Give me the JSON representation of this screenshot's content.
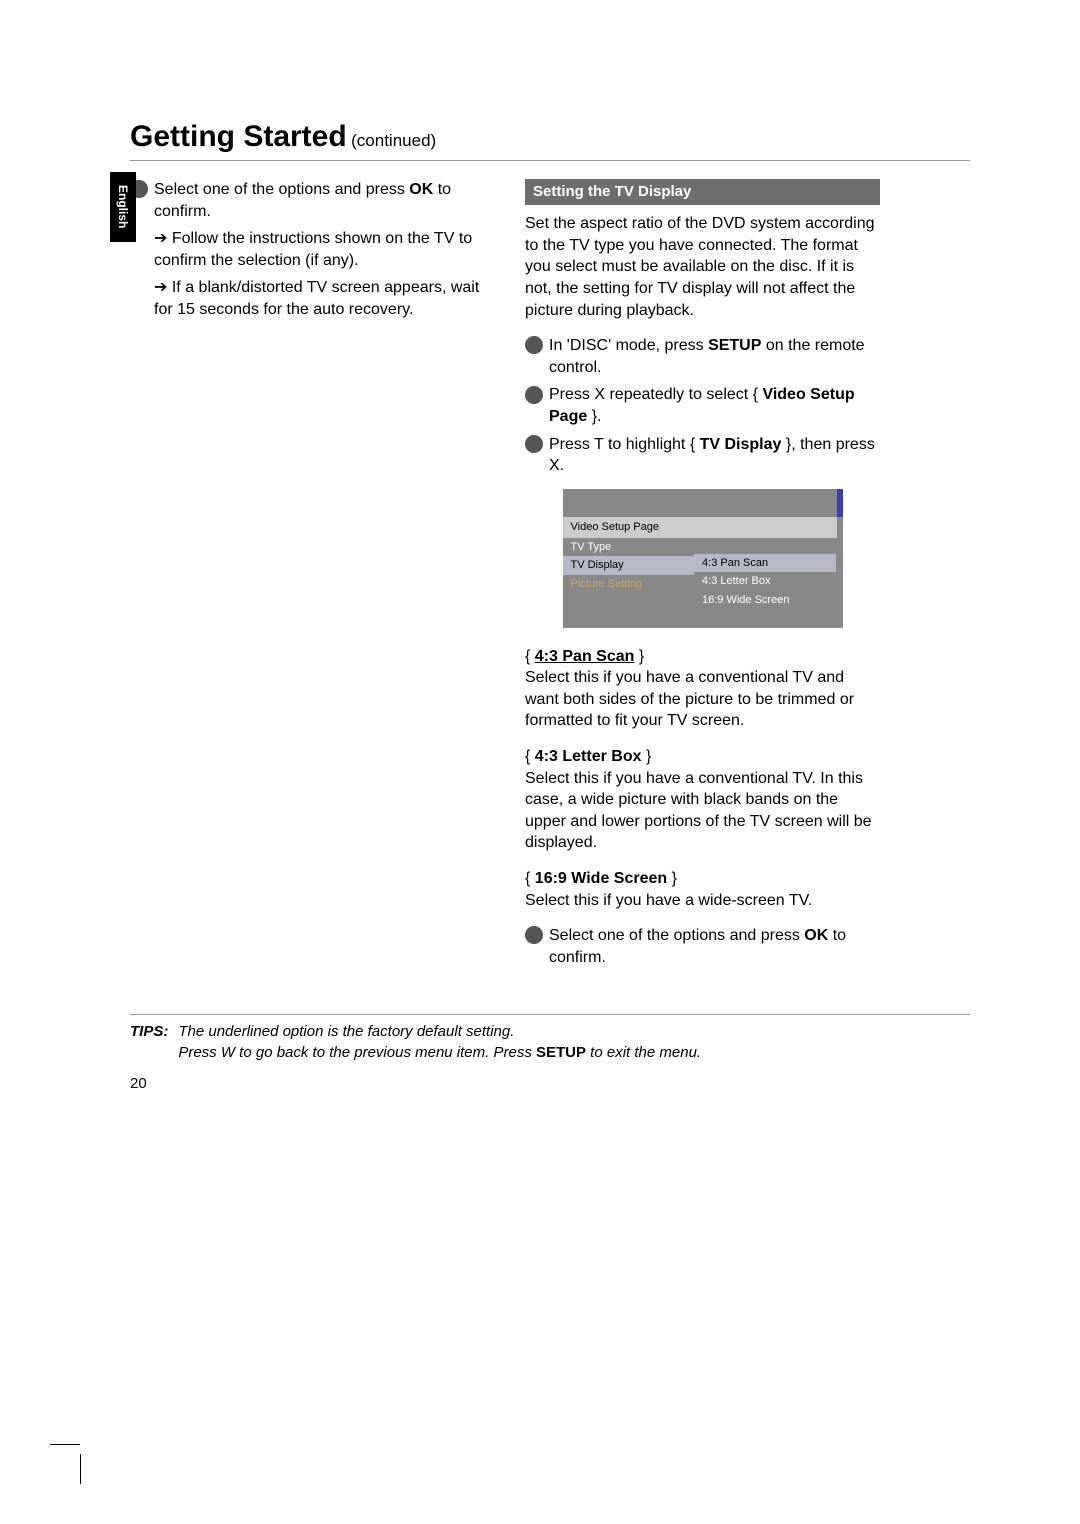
{
  "language_tab": "English",
  "title": {
    "main": "Getting Started",
    "sub": "(continued)"
  },
  "left": {
    "step4_a": "Select one of the options and press ",
    "step4_ok": "OK",
    "step4_b": " to confirm.",
    "arrow1": "Follow the instructions shown on the TV to confirm the selection (if any).",
    "arrow2": "If a blank/distorted TV screen appears, wait for 15 seconds for the auto recovery."
  },
  "right": {
    "section_header": "Setting the TV Display",
    "intro": "Set the aspect ratio of the DVD system according to the TV type you have connected. The format you select must be available on the disc.  If it is not, the setting for TV display will not affect the picture during playback.",
    "step1_a": "In 'DISC' mode, press ",
    "step1_setup": "SETUP",
    "step1_b": " on the remote control.",
    "step2_a": "Press  X repeatedly to select { ",
    "step2_bold": "Video Setup Page",
    "step2_b": " }.",
    "step3_a": "Press  T to highlight { ",
    "step3_bold": "TV Display",
    "step3_b": " }, then press  X.",
    "osd": {
      "title": "Video Setup Page",
      "left_items": [
        "TV Type",
        "TV Display",
        "Picture Setting"
      ],
      "right_items": [
        "4:3 Pan Scan",
        "4:3 Letter Box",
        "16:9 Wide Screen"
      ]
    },
    "opt1_label": "4:3 Pan Scan",
    "opt1_text": "Select this if you have a conventional TV and want both sides of the picture to be trimmed or formatted to fit your TV screen.",
    "opt2_label": "4:3 Letter Box",
    "opt2_text": "Select this if you have a conventional TV.  In this case, a wide picture with black bands on the upper and lower portions of the TV screen will be displayed.",
    "opt3_label": "16:9 Wide Screen",
    "opt3_text": "Select this if you have a wide-screen TV.",
    "step4_a": "Select one of the options and press ",
    "step4_ok": "OK",
    "step4_b": " to confirm."
  },
  "tips": {
    "label": "TIPS:",
    "line1": "The underlined option is the factory default setting.",
    "line2_a": "Press  W to go back to the previous menu item.  Press ",
    "line2_setup": "SETUP",
    "line2_b": " to exit the menu."
  },
  "page_number": "20"
}
